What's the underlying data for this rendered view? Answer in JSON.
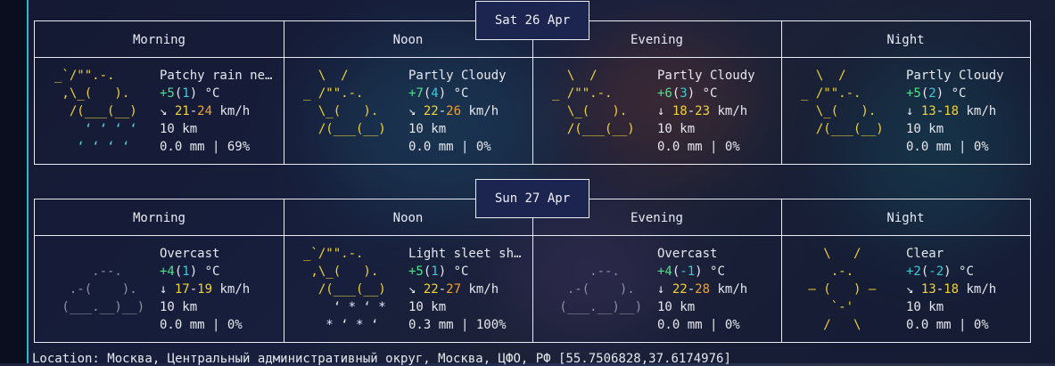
{
  "days": [
    {
      "date": "Sat 26 Apr",
      "periods": [
        {
          "name": "Morning",
          "icon_lines": [
            "_`/\"\".-.",
            " ,\\_(   ).",
            "  /(___(__)",
            "    ʻ ʻ ʻ ʻ",
            "   ʻ ʻ ʻ ʻ"
          ],
          "desc": "Patchy rain ne…",
          "temp_a": "+5",
          "temp_b": "1",
          "temp_unit": "°C",
          "wind_dir": "↘",
          "wind_a": "21",
          "wind_b": "24",
          "wind_unit": "km/h",
          "vis": "10 km",
          "precip": "0.0 mm | 69%"
        },
        {
          "name": "Noon",
          "icon_lines": [
            "  \\  /",
            "_ /\"\".-.",
            "  \\_(   ).",
            "  /(___(__)",
            ""
          ],
          "desc": "Partly Cloudy",
          "temp_a": "+7",
          "temp_b": "4",
          "temp_unit": "°C",
          "wind_dir": "↘",
          "wind_a": "22",
          "wind_b": "26",
          "wind_unit": "km/h",
          "vis": "10 km",
          "precip": "0.0 mm | 0%"
        },
        {
          "name": "Evening",
          "icon_lines": [
            "  \\  /",
            "_ /\"\".-.",
            "  \\_(   ).",
            "  /(___(__)",
            ""
          ],
          "desc": "Partly Cloudy",
          "temp_a": "+6",
          "temp_b": "3",
          "temp_unit": "°C",
          "wind_dir": "↓",
          "wind_a": "18",
          "wind_b": "23",
          "wind_unit": "km/h",
          "vis": "10 km",
          "precip": "0.0 mm | 0%"
        },
        {
          "name": "Night",
          "icon_lines": [
            "  \\  /",
            "_ /\"\".-.",
            "  \\_(   ).",
            "  /(___(__)",
            ""
          ],
          "desc": "Partly Cloudy",
          "temp_a": "+5",
          "temp_b": "2",
          "temp_unit": "°C",
          "wind_dir": "↓",
          "wind_a": "13",
          "wind_b": "18",
          "wind_unit": "km/h",
          "vis": "10 km",
          "precip": "0.0 mm | 0%"
        }
      ]
    },
    {
      "date": "Sun 27 Apr",
      "periods": [
        {
          "name": "Morning",
          "icon_lines": [
            "",
            "     .--.",
            "  .-(    ).",
            " (___.__)__)",
            ""
          ],
          "desc": "Overcast",
          "temp_a": "+4",
          "temp_b": "1",
          "temp_unit": "°C",
          "wind_dir": "↓",
          "wind_a": "17",
          "wind_b": "19",
          "wind_unit": "km/h",
          "vis": "10 km",
          "precip": "0.0 mm | 0%"
        },
        {
          "name": "Noon",
          "icon_lines": [
            "_`/\"\".-.",
            " ,\\_(   ).",
            "  /(___(__)",
            "    ʻ * ʻ *",
            "   * ʻ * ʻ"
          ],
          "desc": "Light sleet sh…",
          "temp_a": "+5",
          "temp_b": "1",
          "temp_unit": "°C",
          "wind_dir": "↘",
          "wind_a": "22",
          "wind_b": "27",
          "wind_unit": "km/h",
          "vis": "10 km",
          "precip": "0.3 mm | 100%"
        },
        {
          "name": "Evening",
          "icon_lines": [
            "",
            "     .--.",
            "  .-(    ).",
            " (___.__)__)",
            ""
          ],
          "desc": "Overcast",
          "temp_a": "+4",
          "temp_b": "-1",
          "temp_unit": "°C",
          "wind_dir": "↓",
          "wind_a": "22",
          "wind_b": "28",
          "wind_unit": "km/h",
          "vis": "10 km",
          "precip": "0.0 mm | 0%"
        },
        {
          "name": "Night",
          "icon_lines": [
            "   \\   /",
            "    .-.",
            " ― (   ) ―",
            "    `-'",
            "   /   \\"
          ],
          "desc": "Clear",
          "temp_a": "+2",
          "temp_b": "-2",
          "temp_unit": "°C",
          "wind_dir": "↘",
          "wind_a": "13",
          "wind_b": "18",
          "wind_unit": "km/h",
          "vis": "10 km",
          "precip": "0.0 mm | 0%"
        }
      ]
    }
  ],
  "location": "Location: Москва, Центральный административный округ, Москва, ЦФО, РФ [55.7506828,37.6174976]",
  "colors": {
    "accent_line": "#2fb8c7",
    "border": "#e9ecf4",
    "sun": "#f2d233",
    "cloud_grey": "#8e939e"
  }
}
